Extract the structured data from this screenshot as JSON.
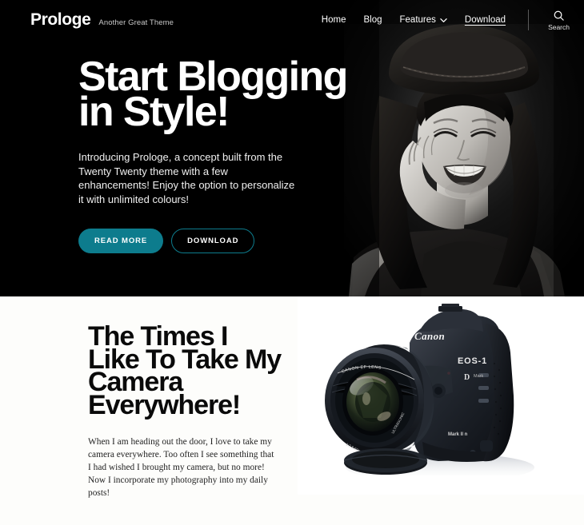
{
  "site": {
    "brand_name": "Prologe",
    "tagline": "Another Great Theme"
  },
  "nav": {
    "items": [
      {
        "label": "Home",
        "icon": null,
        "underlined": false
      },
      {
        "label": "Blog",
        "icon": null,
        "underlined": false
      },
      {
        "label": "Features",
        "icon": "chevron-down-icon",
        "underlined": false
      },
      {
        "label": "Download",
        "icon": null,
        "underlined": true
      }
    ],
    "search": {
      "icon": "search-icon",
      "label": "Search"
    }
  },
  "hero": {
    "title": "Start Blogging in Style!",
    "description": "Introducing Prologe, a concept built from the Twenty Twenty theme with a few enhancements! Enjoy the option to personalize it with unlimited colours!",
    "primary_button": "READ MORE",
    "secondary_button": "DOWNLOAD",
    "image_alt": "Black and white portrait of a smiling woman wearing a hat, resting her chin on her hand"
  },
  "feature": {
    "title": "The Times I Like To Take My Camera Everywhere!",
    "body": "When I am heading out the door, I love to take my camera everywhere. Too often I see something that I had wished I brought my camera, but no more! Now I incorporate my photography into my daily posts!",
    "image_alt": "Canon EOS-1D Mark II DSLR camera with lens on a white background"
  },
  "colors": {
    "accent": "#0d7c8d",
    "hero_background": "#000000",
    "page_background": "#fdfdfb",
    "text_dark": "#0a0a0a",
    "text_light": "#ffffff"
  }
}
